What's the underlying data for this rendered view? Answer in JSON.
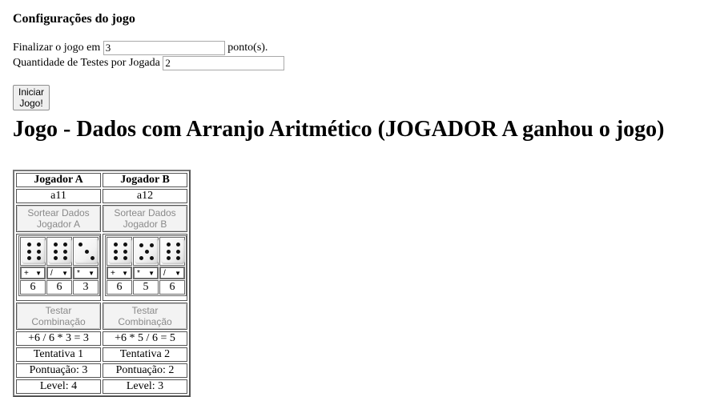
{
  "config": {
    "heading": "Configurações do jogo",
    "finish_label": "Finalizar o jogo em",
    "finish_value": "3",
    "finish_suffix": "ponto(s).",
    "tests_label": "Quantidade de Testes por Jogada",
    "tests_value": "2",
    "start_button": "Iniciar Jogo!"
  },
  "title": "Jogo - Dados com Arranjo Aritmético (JOGADOR A ganhou o jogo)",
  "players": [
    {
      "header": "Jogador A",
      "name": "a11",
      "roll_button": "Sortear Dados Jogador A",
      "dice": [
        6,
        6,
        3
      ],
      "operators": [
        "+",
        "/",
        "*"
      ],
      "test_button": "Testar Combinação",
      "expression": "+6 / 6 * 3 = 3",
      "attempt": "Tentativa 1",
      "score": "Pontuação: 3",
      "level": "Level: 4"
    },
    {
      "header": "Jogador B",
      "name": "a12",
      "roll_button": "Sortear Dados Jogador B",
      "dice": [
        6,
        5,
        6
      ],
      "operators": [
        "+",
        "*",
        "/"
      ],
      "test_button": "Testar Combinação",
      "expression": "+6 * 5 / 6 = 5",
      "attempt": "Tentativa 2",
      "score": "Pontuação: 2",
      "level": "Level: 3"
    }
  ]
}
